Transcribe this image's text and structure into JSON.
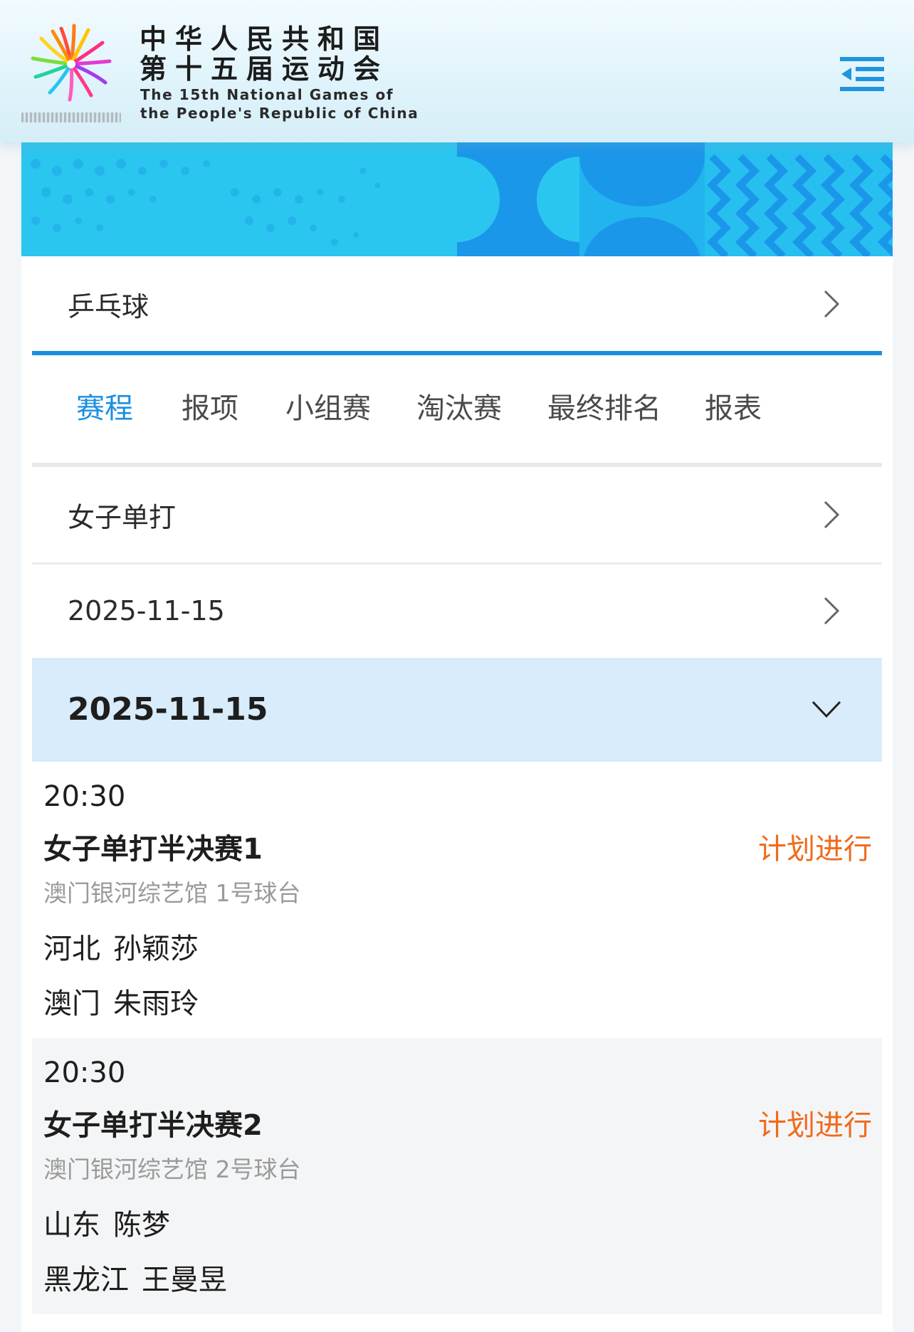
{
  "header": {
    "title_cn_line1": "中华人民共和国",
    "title_cn_line2": "第十五届运动会",
    "title_en_line1": "The 15th National Games of",
    "title_en_line2": "the People's Republic of China",
    "menu_icon": "menu-collapse-icon"
  },
  "sport": {
    "label": "乒乓球"
  },
  "tabs": [
    {
      "label": "赛程",
      "active": true
    },
    {
      "label": "报项",
      "active": false
    },
    {
      "label": "小组赛",
      "active": false
    },
    {
      "label": "淘汰赛",
      "active": false
    },
    {
      "label": "最终排名",
      "active": false
    },
    {
      "label": "报表",
      "active": false
    }
  ],
  "filters": {
    "event": "女子单打",
    "date": "2025-11-15"
  },
  "schedule": {
    "group_date": "2025-11-15",
    "matches": [
      {
        "time": "20:30",
        "name": "女子单打半决赛1",
        "status": "计划进行",
        "venue": "澳门银河综艺馆 1号球台",
        "player1": {
          "team": "河北",
          "name": "孙颖莎"
        },
        "player2": {
          "team": "澳门",
          "name": "朱雨玲"
        }
      },
      {
        "time": "20:30",
        "name": "女子单打半决赛2",
        "status": "计划进行",
        "venue": "澳门银河综艺馆 2号球台",
        "player1": {
          "team": "山东",
          "name": "陈梦"
        },
        "player2": {
          "team": "黑龙江",
          "name": "王曼昱"
        }
      }
    ]
  },
  "colors": {
    "accent": "#1a8ee0",
    "status": "#f06a1b",
    "accordion_bg": "#d8ecfb",
    "banner": "#29c8f1"
  }
}
